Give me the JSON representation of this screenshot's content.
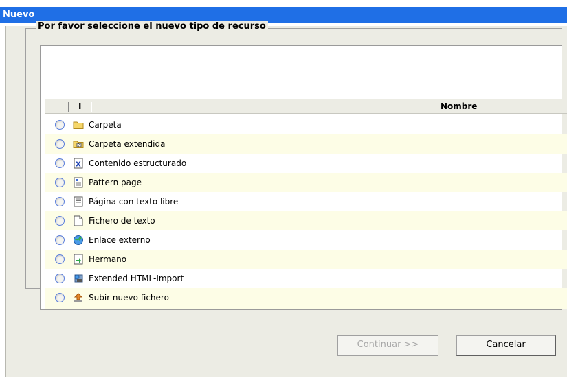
{
  "window": {
    "title": "Nuevo"
  },
  "fieldset": {
    "legend": "Por favor seleccione el nuevo tipo de recurso"
  },
  "table": {
    "headers": {
      "icon": "I",
      "name": "Nombre"
    },
    "rows": [
      {
        "label": "Carpeta",
        "icon": "folder-icon"
      },
      {
        "label": "Carpeta extendida",
        "icon": "extended-folder-icon"
      },
      {
        "label": "Contenido estructurado",
        "icon": "structured-content-icon"
      },
      {
        "label": "Pattern page",
        "icon": "pattern-page-icon"
      },
      {
        "label": "Página con texto libre",
        "icon": "free-text-page-icon"
      },
      {
        "label": "Fichero de texto",
        "icon": "text-file-icon"
      },
      {
        "label": "Enlace externo",
        "icon": "external-link-icon"
      },
      {
        "label": "Hermano",
        "icon": "sibling-icon"
      },
      {
        "label": "Extended HTML-Import",
        "icon": "html-import-icon"
      },
      {
        "label": "Subir nuevo fichero",
        "icon": "upload-icon"
      }
    ]
  },
  "buttons": {
    "continue": "Continuar >>",
    "cancel": "Cancelar"
  },
  "colors": {
    "titlebar": "#1f6fe6",
    "dialog_bg": "#ecece4",
    "alt_row": "#fdfde6"
  }
}
